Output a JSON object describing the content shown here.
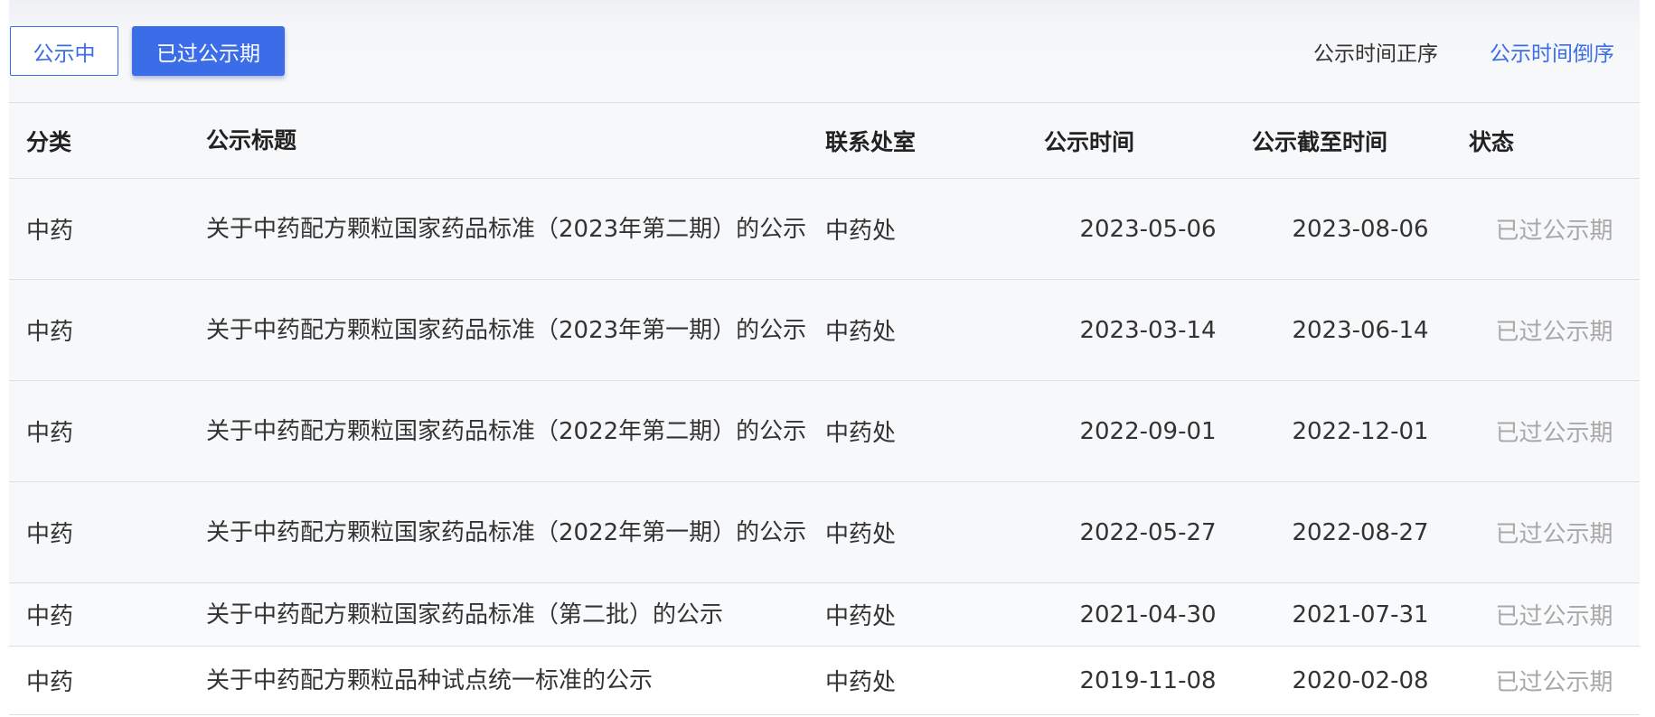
{
  "filters": {
    "active_label": "公示中",
    "expired_label": "已过公示期"
  },
  "sort": {
    "asc_label": "公示时间正序",
    "desc_label": "公示时间倒序"
  },
  "table": {
    "headers": [
      "分类",
      "公示标题",
      "联系处室",
      "公示时间",
      "公示截至时间",
      "状态"
    ],
    "rows": [
      {
        "category": "中药",
        "title": "关于中药配方颗粒国家药品标准（2023年第二期）的公示",
        "dept": "中药处",
        "publish_date": "2023-05-06",
        "end_date": "2023-08-06",
        "status": "已过公示期"
      },
      {
        "category": "中药",
        "title": "关于中药配方颗粒国家药品标准（2023年第一期）的公示",
        "dept": "中药处",
        "publish_date": "2023-03-14",
        "end_date": "2023-06-14",
        "status": "已过公示期"
      },
      {
        "category": "中药",
        "title": "关于中药配方颗粒国家药品标准（2022年第二期）的公示",
        "dept": "中药处",
        "publish_date": "2022-09-01",
        "end_date": "2022-12-01",
        "status": "已过公示期"
      },
      {
        "category": "中药",
        "title": "关于中药配方颗粒国家药品标准（2022年第一期）的公示",
        "dept": "中药处",
        "publish_date": "2022-05-27",
        "end_date": "2022-08-27",
        "status": "已过公示期"
      },
      {
        "category": "中药",
        "title": "关于中药配方颗粒国家药品标准（第二批）的公示",
        "dept": "中药处",
        "publish_date": "2021-04-30",
        "end_date": "2021-07-31",
        "status": "已过公示期"
      },
      {
        "category": "中药",
        "title": "关于中药配方颗粒品种试点统一标准的公示",
        "dept": "中药处",
        "publish_date": "2019-11-08",
        "end_date": "2020-02-08",
        "status": "已过公示期"
      }
    ]
  },
  "colors": {
    "accent": "#3b6de8",
    "status_text": "#a8a8a8"
  }
}
